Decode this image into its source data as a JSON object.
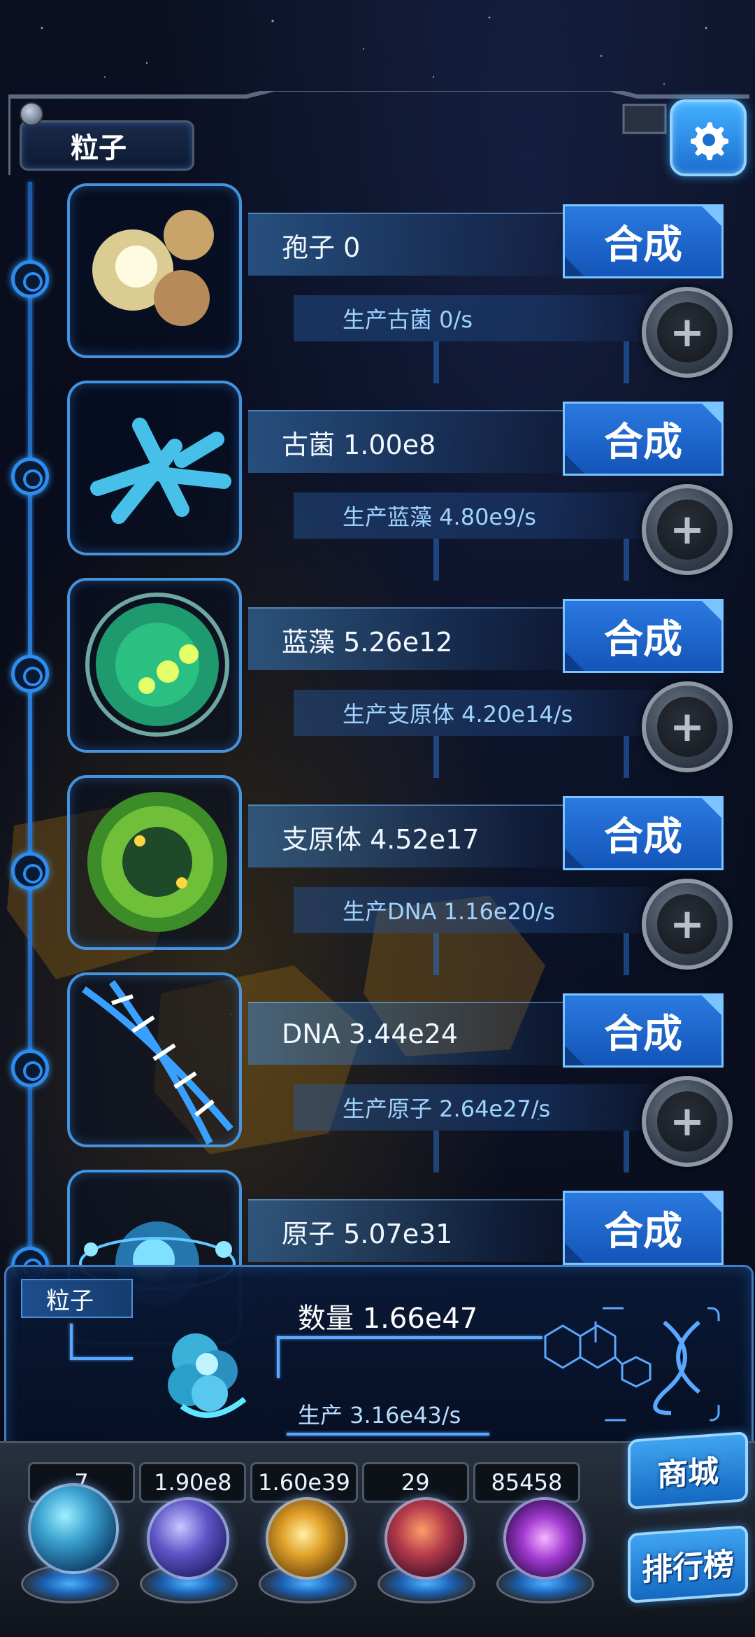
{
  "header": {
    "title": "粒子",
    "settings_icon": "gear-icon"
  },
  "rows": [
    {
      "name_value": "孢子 0",
      "production": "生产古菌 0/s",
      "synth_label": "合成",
      "icon": "spore-icon"
    },
    {
      "name_value": "古菌 1.00e8",
      "production": "生产蓝藻 4.80e9/s",
      "synth_label": "合成",
      "icon": "archaea-icon"
    },
    {
      "name_value": "蓝藻 5.26e12",
      "production": "生产支原体 4.20e14/s",
      "synth_label": "合成",
      "icon": "cyanobacteria-icon"
    },
    {
      "name_value": "支原体 4.52e17",
      "production": "生产DNA 1.16e20/s",
      "synth_label": "合成",
      "icon": "mycoplasma-icon"
    },
    {
      "name_value": "DNA 3.44e24",
      "production": "生产原子 2.64e27/s",
      "synth_label": "合成",
      "icon": "dna-icon"
    },
    {
      "name_value": "原子 5.07e31",
      "production": "",
      "synth_label": "合成",
      "icon": "atom-icon"
    }
  ],
  "panel": {
    "tag": "粒子",
    "quantity": "数量 1.66e47",
    "production": "生产 3.16e43/s"
  },
  "bottom": {
    "counters": [
      "7",
      "1.90e8",
      "1.60e39",
      "29",
      "85458"
    ],
    "shop_label": "商城",
    "ranking_label": "排行榜",
    "orbs": [
      "particle-orb-icon",
      "lightning-orb-icon",
      "galaxy-orb-icon",
      "brain-orb-icon",
      "vortex-orb-icon"
    ]
  },
  "colors": {
    "accent": "#2c8cf0",
    "button": "#1f6fd6",
    "background": "#0a0f20"
  }
}
